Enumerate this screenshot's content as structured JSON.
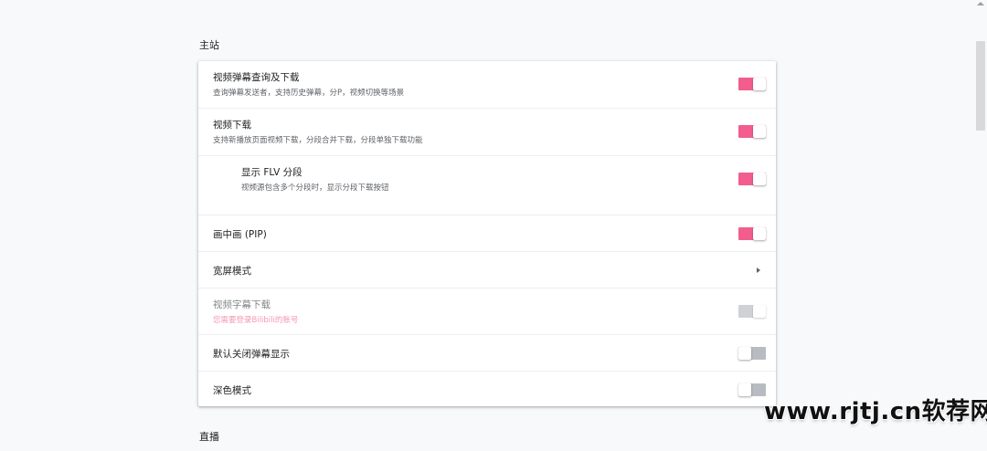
{
  "sections": {
    "main_title": "主站",
    "live_title": "直播"
  },
  "settings": [
    {
      "title": "视频弹幕查询及下载",
      "sub": "查询弹幕发送者，支持历史弹幕，分P，视频切换等场景",
      "control": "toggle",
      "state": "on"
    },
    {
      "title": "视频下载",
      "sub": "支持新播放页面视频下载，分段合并下载，分段单独下载功能",
      "control": "toggle",
      "state": "on"
    },
    {
      "title": "显示 FLV 分段",
      "sub": "视频源包含多个分段时，显示分段下载按钮",
      "control": "toggle",
      "state": "on"
    },
    {
      "title": "画中画 (PIP)",
      "sub": "",
      "control": "toggle",
      "state": "on"
    },
    {
      "title": "宽屏模式",
      "sub": "",
      "control": "chevron-right-icon",
      "state": ""
    },
    {
      "title": "视频字幕下载",
      "sub": "您需要登录Bilibili的账号",
      "control": "toggle",
      "state": "disabled"
    },
    {
      "title": "默认关闭弹幕显示",
      "sub": "",
      "control": "toggle",
      "state": "off"
    },
    {
      "title": "深色模式",
      "sub": "",
      "control": "toggle",
      "state": "off"
    }
  ],
  "watermark": "www.rjtj.cn软荐网",
  "colors": {
    "toggle_on": "#f25d8e",
    "toggle_off": "#b8bcc2",
    "warning_text": "#f498b5"
  }
}
